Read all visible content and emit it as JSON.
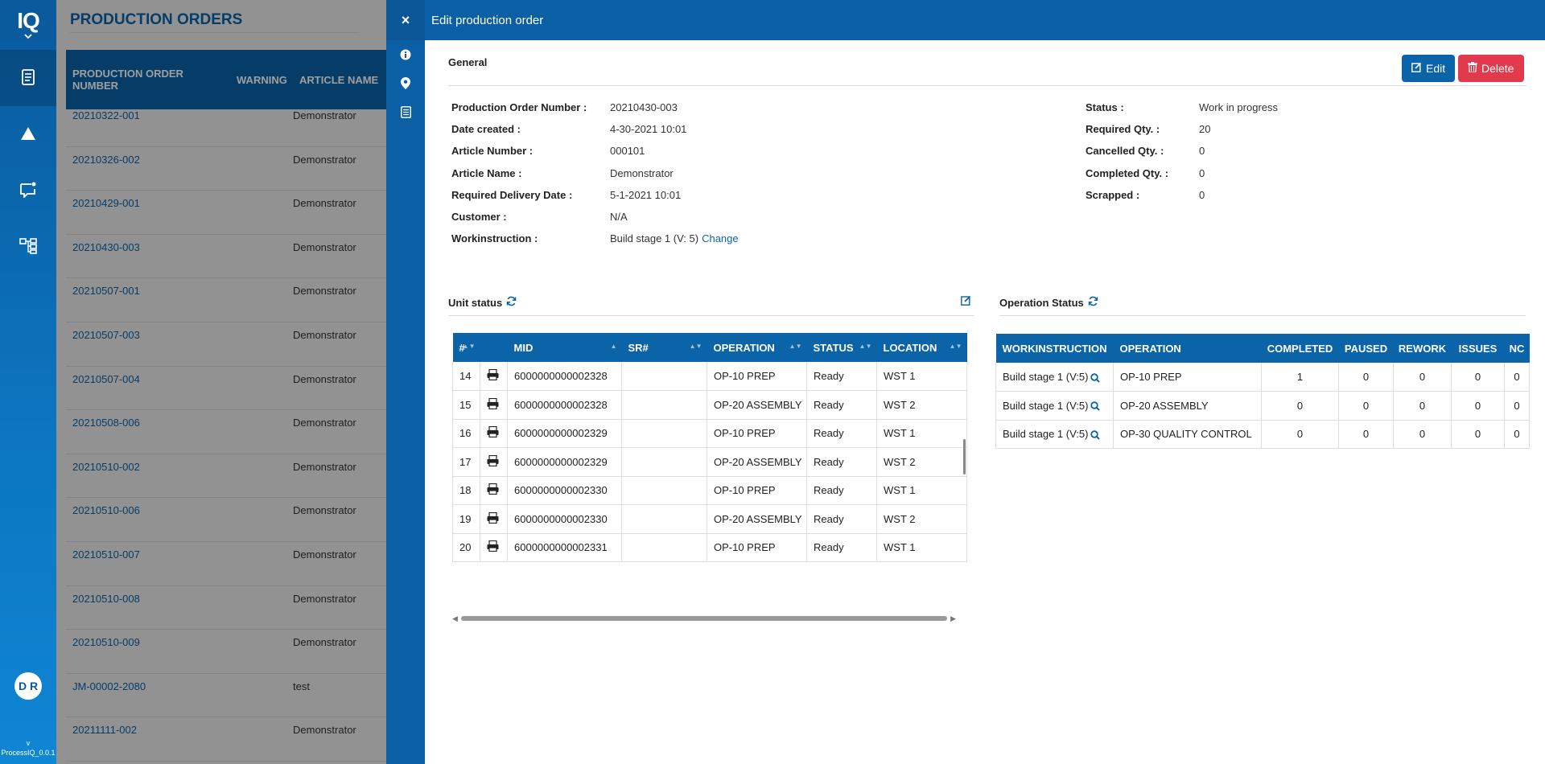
{
  "rail": {
    "logo": "IQ",
    "avatar_initials": "D R",
    "version_caret": "v",
    "version": "ProcessIQ_0.0.1"
  },
  "list": {
    "title": "PRODUCTION ORDERS",
    "columns": [
      "PRODUCTION ORDER NUMBER",
      "WARNING",
      "ARTICLE NAME"
    ],
    "rows": [
      {
        "number": "20210322-001",
        "article": "Demonstrator"
      },
      {
        "number": "20210326-002",
        "article": "Demonstrator"
      },
      {
        "number": "20210429-001",
        "article": "Demonstrator"
      },
      {
        "number": "20210430-003",
        "article": "Demonstrator"
      },
      {
        "number": "20210507-001",
        "article": "Demonstrator"
      },
      {
        "number": "20210507-003",
        "article": "Demonstrator"
      },
      {
        "number": "20210507-004",
        "article": "Demonstrator"
      },
      {
        "number": "20210508-006",
        "article": "Demonstrator"
      },
      {
        "number": "20210510-002",
        "article": "Demonstrator"
      },
      {
        "number": "20210510-006",
        "article": "Demonstrator"
      },
      {
        "number": "20210510-007",
        "article": "Demonstrator"
      },
      {
        "number": "20210510-008",
        "article": "Demonstrator"
      },
      {
        "number": "20210510-009",
        "article": "Demonstrator"
      },
      {
        "number": "JM-00002-2080",
        "article": "test"
      },
      {
        "number": "20211111-002",
        "article": "Demonstrator"
      }
    ]
  },
  "drawer": {
    "close_glyph": "×",
    "title": "Edit production order",
    "general_title": "General",
    "edit_label": "Edit",
    "delete_label": "Delete",
    "fields_left": [
      {
        "label": "Production Order Number :",
        "value": "20210430-003"
      },
      {
        "label": "Date created :",
        "value": "4-30-2021 10:01"
      },
      {
        "label": "Article Number :",
        "value": "000101"
      },
      {
        "label": "Article Name :",
        "value": "Demonstrator"
      },
      {
        "label": "Required Delivery Date :",
        "value": "5-1-2021 10:01"
      },
      {
        "label": "Customer :",
        "value": "N/A"
      },
      {
        "label": "Workinstruction :",
        "value": "Build stage 1 (V: 5)"
      }
    ],
    "change_label": "Change",
    "fields_right": [
      {
        "label": "Status :",
        "value": "Work in progress"
      },
      {
        "label": "Required Qty. :",
        "value": "20"
      },
      {
        "label": "Cancelled Qty. :",
        "value": "0"
      },
      {
        "label": "Completed Qty. :",
        "value": "0"
      },
      {
        "label": "Scrapped :",
        "value": "0"
      }
    ],
    "unit_status": {
      "title": "Unit status",
      "columns": [
        "#",
        "",
        "MID",
        "SR#",
        "OPERATION",
        "STATUS",
        "LOCATION"
      ],
      "rows": [
        {
          "n": "14",
          "mid": "6000000000002328",
          "sr": "",
          "op": "OP-10 PREP",
          "status": "Ready",
          "loc": "WST 1"
        },
        {
          "n": "15",
          "mid": "6000000000002328",
          "sr": "",
          "op": "OP-20 ASSEMBLY",
          "status": "Ready",
          "loc": "WST 2"
        },
        {
          "n": "16",
          "mid": "6000000000002329",
          "sr": "",
          "op": "OP-10 PREP",
          "status": "Ready",
          "loc": "WST 1"
        },
        {
          "n": "17",
          "mid": "6000000000002329",
          "sr": "",
          "op": "OP-20 ASSEMBLY",
          "status": "Ready",
          "loc": "WST 2"
        },
        {
          "n": "18",
          "mid": "6000000000002330",
          "sr": "",
          "op": "OP-10 PREP",
          "status": "Ready",
          "loc": "WST 1"
        },
        {
          "n": "19",
          "mid": "6000000000002330",
          "sr": "",
          "op": "OP-20 ASSEMBLY",
          "status": "Ready",
          "loc": "WST 2"
        },
        {
          "n": "20",
          "mid": "6000000000002331",
          "sr": "",
          "op": "OP-10 PREP",
          "status": "Ready",
          "loc": "WST 1"
        }
      ]
    },
    "operation_status": {
      "title": "Operation Status",
      "columns": [
        "WORKINSTRUCTION",
        "OPERATION",
        "COMPLETED",
        "PAUSED",
        "REWORK",
        "ISSUES",
        "NC"
      ],
      "rows": [
        {
          "wi": "Build stage 1 (V:5)",
          "op": "OP-10 PREP",
          "completed": "1",
          "paused": "0",
          "rework": "0",
          "issues": "0",
          "nc": "0"
        },
        {
          "wi": "Build stage 1 (V:5)",
          "op": "OP-20 ASSEMBLY",
          "completed": "0",
          "paused": "0",
          "rework": "0",
          "issues": "0",
          "nc": "0"
        },
        {
          "wi": "Build stage 1 (V:5)",
          "op": "OP-30 QUALITY CONTROL",
          "completed": "0",
          "paused": "0",
          "rework": "0",
          "issues": "0",
          "nc": "0"
        }
      ]
    }
  },
  "colors": {
    "primary": "#0b63a8",
    "danger": "#e03a4c",
    "header": "#0b5fa5"
  }
}
